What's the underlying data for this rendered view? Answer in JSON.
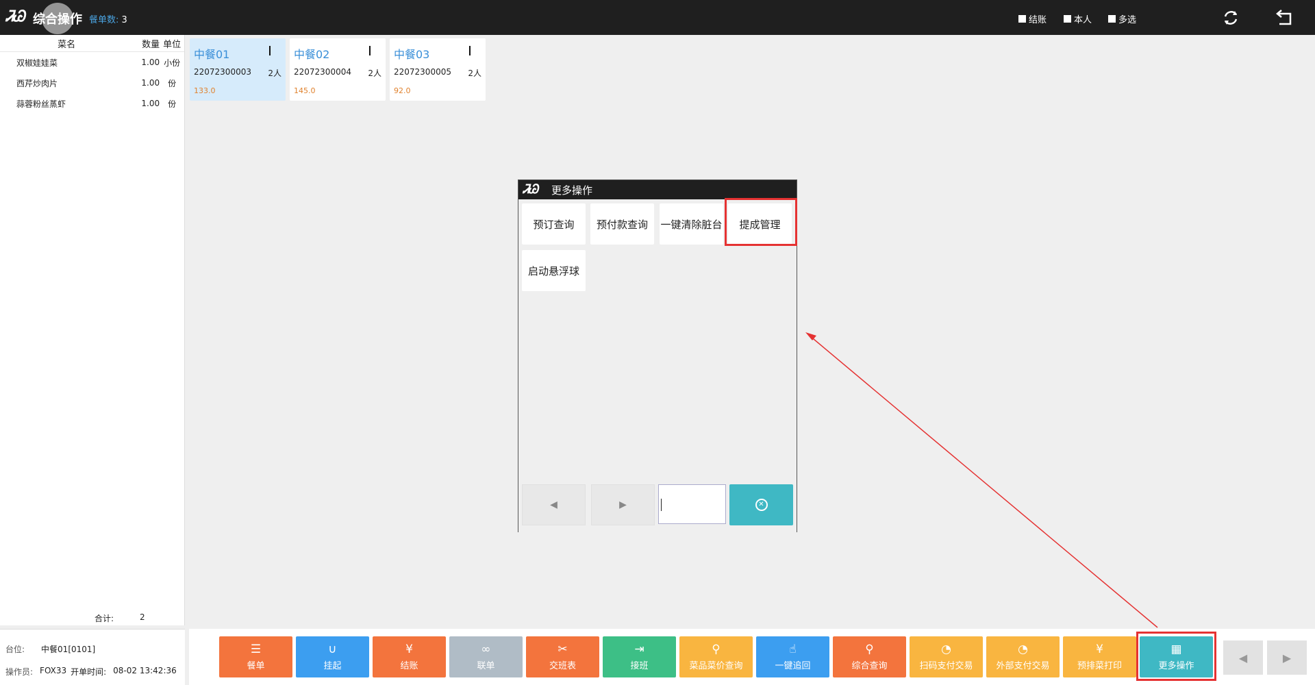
{
  "topbar": {
    "logo": "ᏘᏊ",
    "title": "综合操作",
    "order_count_label": "餐单数:",
    "order_count_value": "3",
    "checks": [
      "结账",
      "本人",
      "多选"
    ]
  },
  "order_panel": {
    "headers": {
      "name": "菜名",
      "qty": "数量",
      "unit": "单位"
    },
    "items": [
      {
        "name": "双椒娃娃菜",
        "qty": "1.00",
        "unit": "小份"
      },
      {
        "name": "西芹炒肉片",
        "qty": "1.00",
        "unit": "份"
      },
      {
        "name": "蒜蓉粉丝蒸虾",
        "qty": "1.00",
        "unit": "份"
      }
    ],
    "total_label": "合计:",
    "total_value": "2"
  },
  "info": {
    "table_label": "台位:",
    "table_value": "中餐01[0101]",
    "operator_label": "操作员:",
    "operator_value": "FOX33",
    "open_time_label": "开单时间:",
    "open_time_value": "08-02 13:42:36"
  },
  "tables": [
    {
      "name": "中餐01",
      "order_no": "22072300003",
      "people": "2人",
      "amount": "133.0",
      "selected": true
    },
    {
      "name": "中餐02",
      "order_no": "22072300004",
      "people": "2人",
      "amount": "145.0",
      "selected": false
    },
    {
      "name": "中餐03",
      "order_no": "22072300005",
      "people": "2人",
      "amount": "92.0",
      "selected": false
    }
  ],
  "dialog": {
    "title": "更多操作",
    "operations": [
      "预订查询",
      "预付款查询",
      "一键清除脏台",
      "提成管理",
      "启动悬浮球"
    ],
    "input_value": ""
  },
  "bottom_buttons": [
    {
      "label": "餐单",
      "icon": "list-icon",
      "color": "#f3743d"
    },
    {
      "label": "挂起",
      "icon": "magnet-icon",
      "color": "#3c9ef0"
    },
    {
      "label": "结账",
      "icon": "yen-icon",
      "color": "#f3743d"
    },
    {
      "label": "联单",
      "icon": "link-icon",
      "color": "#b0bcc6"
    },
    {
      "label": "交班表",
      "icon": "cross-icon",
      "color": "#f3743d"
    },
    {
      "label": "接班",
      "icon": "user-in-icon",
      "color": "#3dbf86"
    },
    {
      "label": "菜品菜价查询",
      "icon": "search-icon",
      "color": "#f9b540"
    },
    {
      "label": "一键追回",
      "icon": "hand-icon",
      "color": "#3c9ef0"
    },
    {
      "label": "综合查询",
      "icon": "search-icon",
      "color": "#f3743d"
    },
    {
      "label": "扫码支付交易",
      "icon": "pie-icon",
      "color": "#f9b540"
    },
    {
      "label": "外部支付交易",
      "icon": "pie-icon",
      "color": "#f9b540"
    },
    {
      "label": "预排菜打印",
      "icon": "yen-icon",
      "color": "#f9b540"
    },
    {
      "label": "更多操作",
      "icon": "grid-icon",
      "color": "#3fb8c4"
    }
  ]
}
